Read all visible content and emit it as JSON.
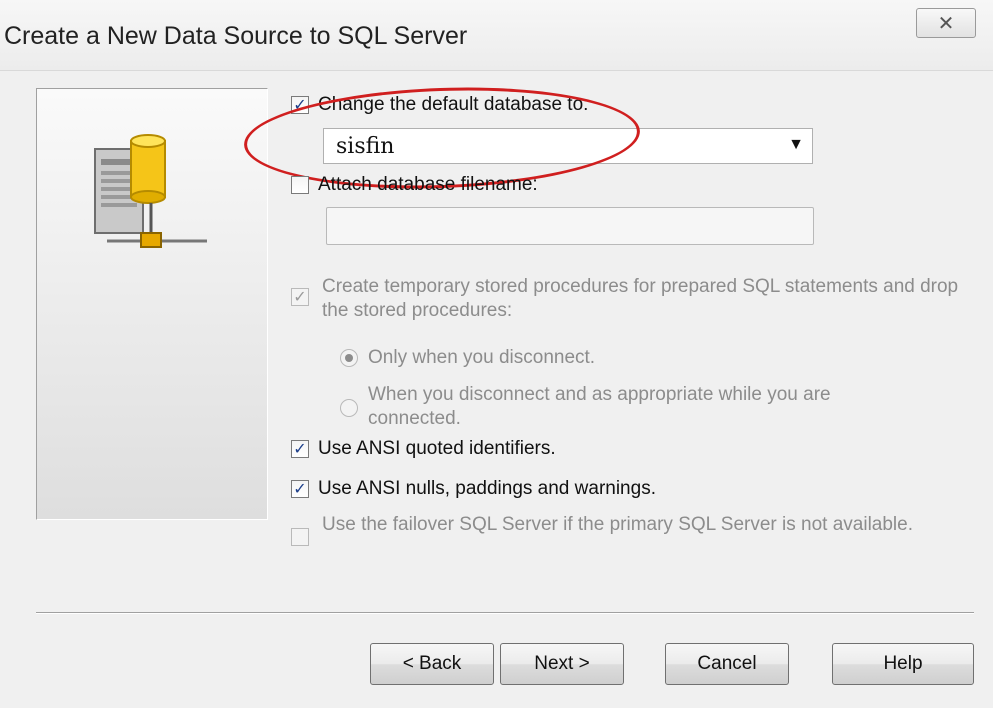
{
  "window": {
    "title": "Create a New Data Source to SQL Server",
    "close_glyph": "☒"
  },
  "options": {
    "change_default_db": {
      "label": "Change the default database to:",
      "checked": true
    },
    "database_value": "sisfin",
    "attach_db_filename": {
      "label": "Attach database filename:",
      "checked": false,
      "value": ""
    },
    "create_temp_procs": {
      "label": "Create temporary stored procedures for prepared SQL statements and drop the stored procedures:",
      "checked": true,
      "disabled": true
    },
    "radio_only_disconnect": {
      "label": "Only when you disconnect.",
      "selected": true
    },
    "radio_disconnect_appropriate": {
      "label": "When you disconnect and as appropriate while you are connected.",
      "selected": false
    },
    "ansi_quoted": {
      "label": "Use ANSI quoted identifiers.",
      "checked": true
    },
    "ansi_nulls": {
      "label": "Use ANSI nulls, paddings and warnings.",
      "checked": true
    },
    "failover": {
      "label": "Use the failover SQL Server if the primary SQL Server is not available.",
      "checked": false,
      "disabled": true
    }
  },
  "buttons": {
    "back": "< Back",
    "next": "Next >",
    "cancel": "Cancel",
    "help": "Help"
  },
  "icons": {
    "dropdown": "chevron-down-icon",
    "server": "database-server-icon"
  },
  "colors": {
    "highlight_ellipse": "#d01f1f",
    "check_mark": "#1d3f8a"
  }
}
